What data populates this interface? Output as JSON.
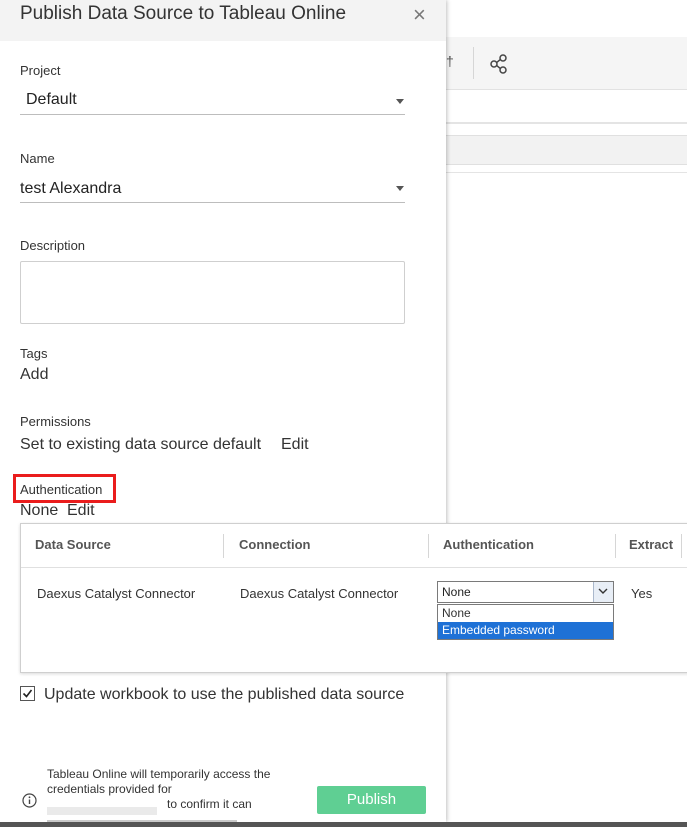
{
  "dialog": {
    "title": "Publish Data Source to Tableau Online",
    "close_glyph": "×"
  },
  "project": {
    "label": "Project",
    "value": "Default"
  },
  "name": {
    "label": "Name",
    "value": "test Alexandra"
  },
  "description": {
    "label": "Description",
    "value": ""
  },
  "tags": {
    "label": "Tags",
    "add_link": "Add"
  },
  "permissions": {
    "label": "Permissions",
    "value": "Set to existing data source default",
    "edit_link": "Edit"
  },
  "authentication": {
    "label": "Authentication",
    "value": "None",
    "edit_link": "Edit"
  },
  "table": {
    "headers": [
      "Data Source",
      "Connection",
      "Authentication",
      "Extract"
    ],
    "rows": [
      {
        "data_source": "Daexus Catalyst Connector",
        "connection": "Daexus Catalyst Connector",
        "authentication": "None",
        "extract": "Yes"
      }
    ],
    "auth_options": [
      "None",
      "Embedded password"
    ],
    "highlighted_option": "Embedded password"
  },
  "update_workbook": {
    "label": "Update workbook to use the published data source",
    "checked": true
  },
  "footer": {
    "note_lines": [
      "Tableau Online will temporarily access the",
      "credentials provided for",
      "to confirm it can"
    ],
    "publish_label": "Publish"
  },
  "background": {
    "toolbar_glyph": "†"
  },
  "icons": {
    "share": "share-icon",
    "info": "info-icon",
    "dropdown": "chevron-down-icon"
  },
  "colors": {
    "accent_link": "#2a7ab8",
    "publish_button": "#5fcf93",
    "highlight_box": "#ea1c1c",
    "selected_option": "#1e71d6"
  }
}
